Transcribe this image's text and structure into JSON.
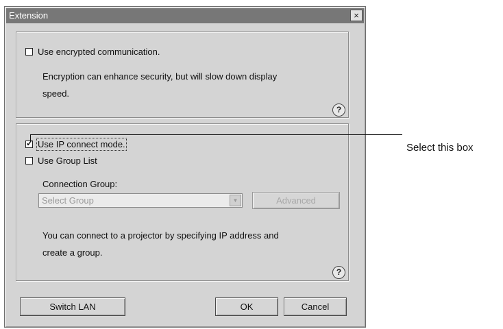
{
  "window": {
    "title": "Extension",
    "close_glyph": "×"
  },
  "encryption": {
    "checkbox_label": "Use encrypted communication.",
    "checked": false,
    "description_line1": "Encryption can enhance security, but will slow down display",
    "description_line2": "speed.",
    "help_glyph": "?"
  },
  "connection": {
    "ip_mode_label": "Use IP connect mode.",
    "ip_mode_checked": true,
    "group_list_label": "Use Group List",
    "group_list_checked": false,
    "group_label": "Connection Group:",
    "group_select_value": "Select Group",
    "advanced_button": "Advanced",
    "description_line1": "You can connect to a projector by specifying IP address and",
    "description_line2": "create a group.",
    "help_glyph": "?"
  },
  "buttons": {
    "switch_lan": "Switch LAN",
    "ok": "OK",
    "cancel": "Cancel"
  },
  "callout": {
    "label": "Select this box"
  }
}
